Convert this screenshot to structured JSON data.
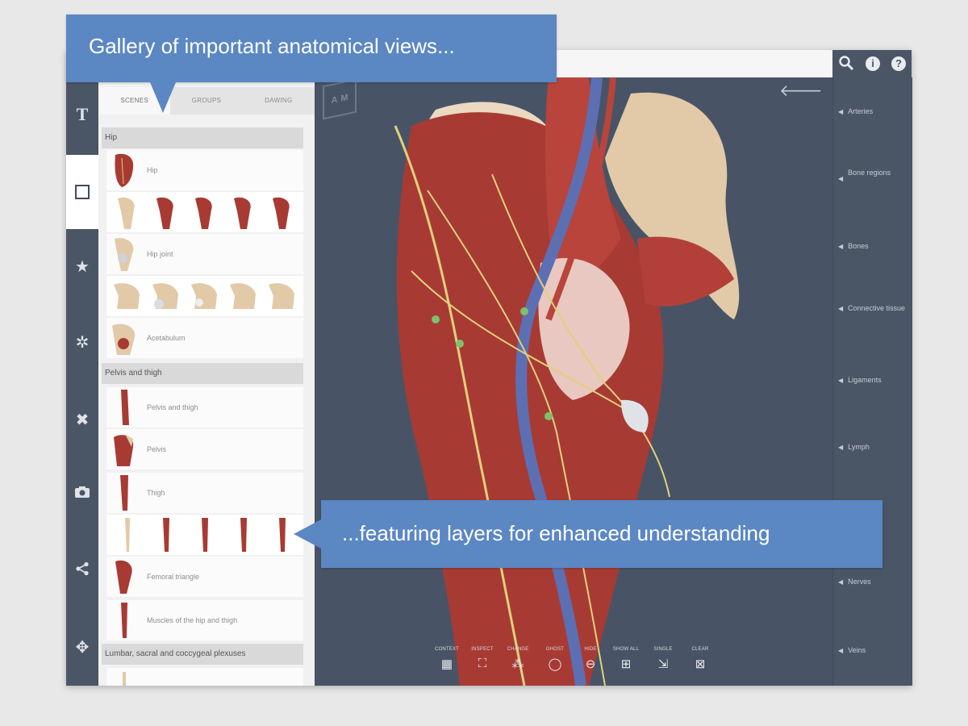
{
  "callouts": {
    "top": "Gallery of important anatomical views...",
    "bottom": "...featuring layers for enhanced understanding"
  },
  "topbar": {
    "icons": [
      "search-icon",
      "info-icon",
      "help-icon"
    ],
    "info_glyph": "i",
    "help_glyph": "?"
  },
  "rail": {
    "items": [
      "text-icon",
      "square-icon",
      "star-icon",
      "gear-icon",
      "tools-icon",
      "camera-icon",
      "share-icon",
      "move-icon"
    ],
    "text_glyph": "T"
  },
  "gallery": {
    "tabs": [
      "SCENES",
      "GROUPS",
      "DAWING"
    ],
    "sections": [
      {
        "title": "Hip",
        "rows": [
          {
            "label": "Hip"
          },
          {
            "label": ""
          },
          {
            "label": "Hip joint"
          },
          {
            "label": ""
          },
          {
            "label": "Acetabulum"
          }
        ]
      },
      {
        "title": "Pelvis and thigh",
        "rows": [
          {
            "label": "Pelvis and thigh"
          },
          {
            "label": "Pelvis"
          },
          {
            "label": "Thigh"
          },
          {
            "label": ""
          },
          {
            "label": "Femoral triangle"
          },
          {
            "label": "Muscles of the hip and thigh"
          }
        ]
      },
      {
        "title": "Lumbar, sacral and coccygeal plexuses",
        "rows": []
      }
    ]
  },
  "viewport": {
    "cube_letters": [
      "A",
      "M"
    ]
  },
  "layers": [
    "Arteries",
    "Bone regions",
    "Bones",
    "Connective tissue",
    "Ligaments",
    "Lymph",
    "Nerves",
    "Veins"
  ],
  "toolbar": [
    {
      "label": "CONTEXT",
      "icon": "context-icon"
    },
    {
      "label": "INSPECT",
      "icon": "inspect-icon"
    },
    {
      "label": "CHANGE",
      "icon": "change-icon"
    },
    {
      "label": "GHOST",
      "icon": "ghost-icon"
    },
    {
      "label": "HIDE",
      "icon": "hide-icon"
    },
    {
      "label": "SHOW ALL",
      "icon": "show-all-icon"
    },
    {
      "label": "SINGLE",
      "icon": "single-icon"
    },
    {
      "label": "CLEAR",
      "icon": "clear-icon"
    }
  ],
  "colors": {
    "accent": "#5b87c3",
    "chrome": "#4a5566",
    "muscle": "#a83a34",
    "bone": "#e2c9a8",
    "nerve": "#e0d17a",
    "vein": "#5d6fb3"
  }
}
